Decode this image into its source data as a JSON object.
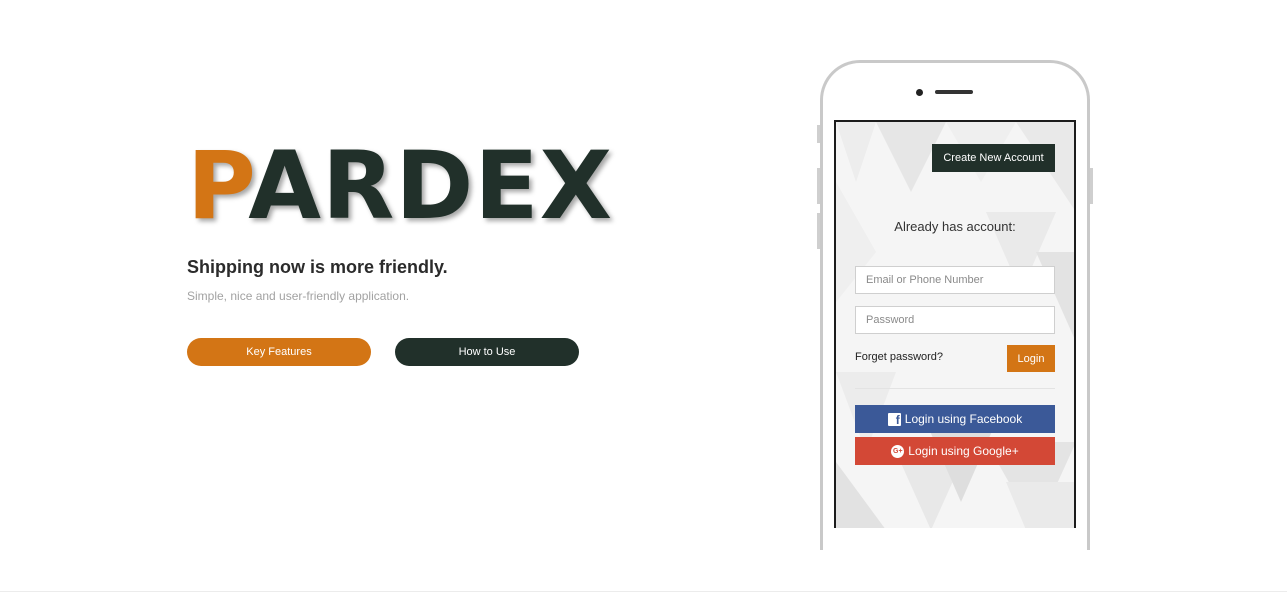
{
  "logo": {
    "first_letter": "P",
    "rest": "ARDEX"
  },
  "hero": {
    "headline": "Shipping now is more friendly.",
    "subline": "Simple, nice and user-friendly application.",
    "key_features_label": "Key Features",
    "how_to_use_label": "How to Use"
  },
  "phone": {
    "create_account_label": "Create New Account",
    "already_text": "Already has account:",
    "email_placeholder": "Email or Phone Number",
    "password_placeholder": "Password",
    "forget_label": "Forget password?",
    "login_label": "Login",
    "facebook_label": "Login using Facebook",
    "google_label": "Login using Google+",
    "facebook_icon": "facebook-icon",
    "google_icon": "google-plus-icon"
  },
  "colors": {
    "accent": "#d37515",
    "dark": "#21302a",
    "facebook": "#3b5998",
    "google": "#d34836"
  }
}
